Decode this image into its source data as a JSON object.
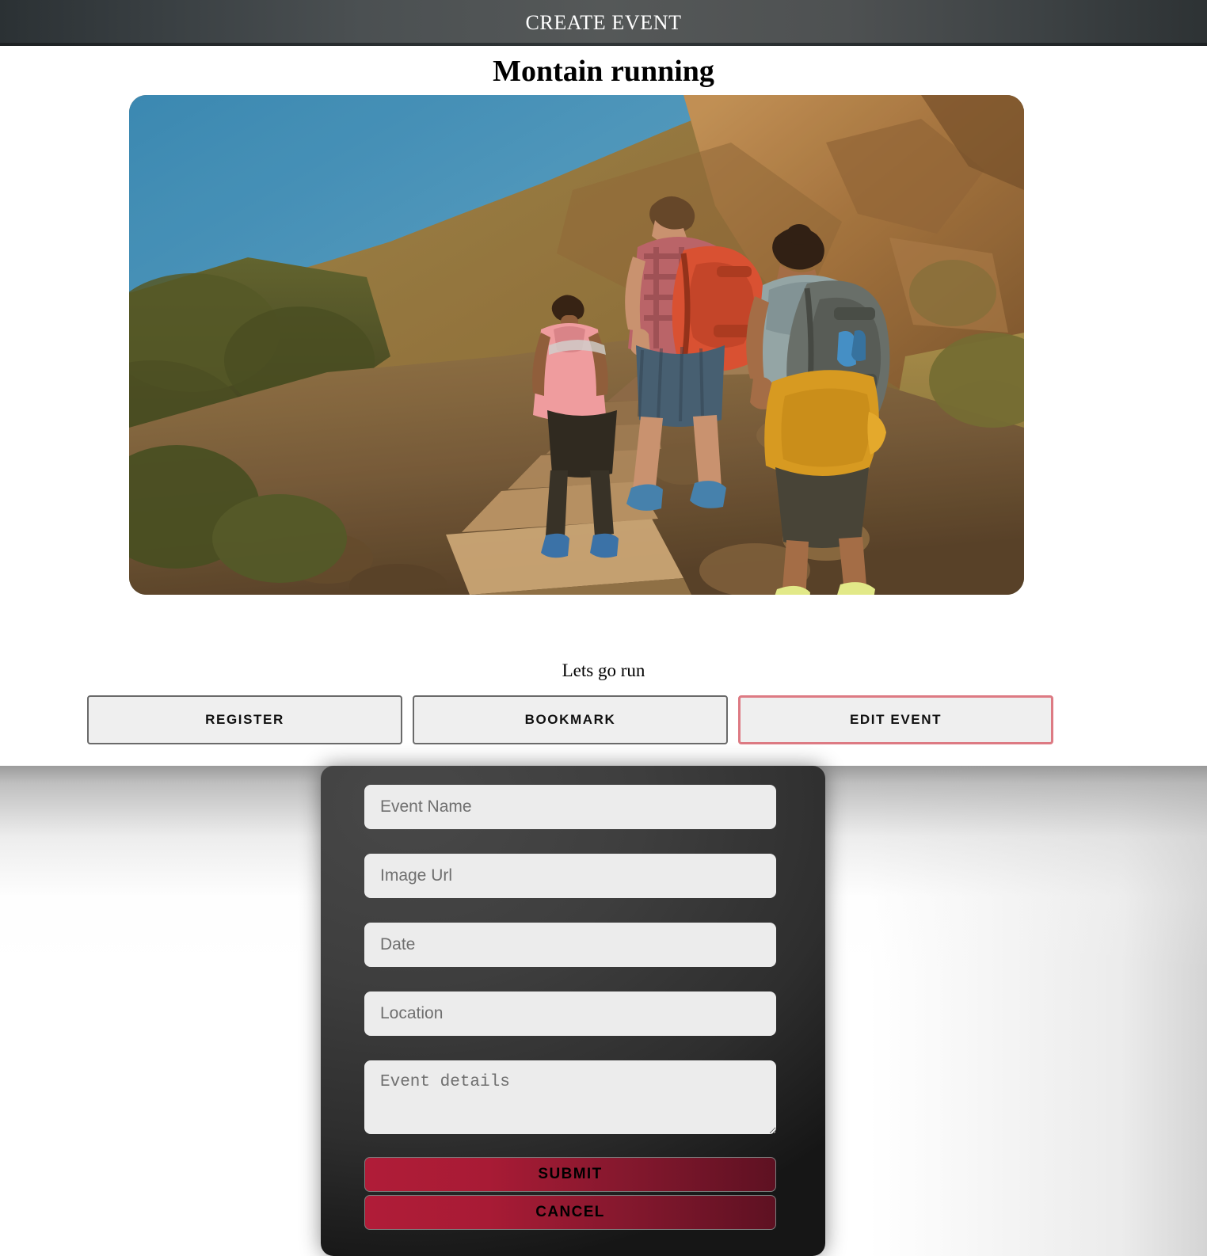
{
  "header": {
    "title": "CREATE EVENT"
  },
  "event": {
    "title": "Montain running",
    "caption": "Lets go run",
    "image_alt": "three-hikers-climbing-rocky-mountain-trail"
  },
  "actions": [
    {
      "label": "REGISTER",
      "name": "register-button",
      "accent": false
    },
    {
      "label": "BOOKMARK",
      "name": "bookmark-button",
      "accent": false
    },
    {
      "label": "EDIT EVENT",
      "name": "edit-event-button",
      "accent": true
    }
  ],
  "form": {
    "event_name": {
      "placeholder": "Event Name",
      "value": ""
    },
    "image_url": {
      "placeholder": "Image Url",
      "value": ""
    },
    "date": {
      "placeholder": "Date",
      "value": ""
    },
    "location": {
      "placeholder": "Location",
      "value": ""
    },
    "details": {
      "placeholder": "Event details",
      "value": ""
    },
    "submit_label": "SUBMIT",
    "cancel_label": "CANCEL"
  },
  "colors": {
    "header_gradient_dark": "#2b3134",
    "header_gradient_light": "#555858",
    "accent_border": "#dd7a83",
    "modal_background": "#3e3e3e",
    "modal_button_red": "#a81b35",
    "field_background": "#ececec"
  }
}
